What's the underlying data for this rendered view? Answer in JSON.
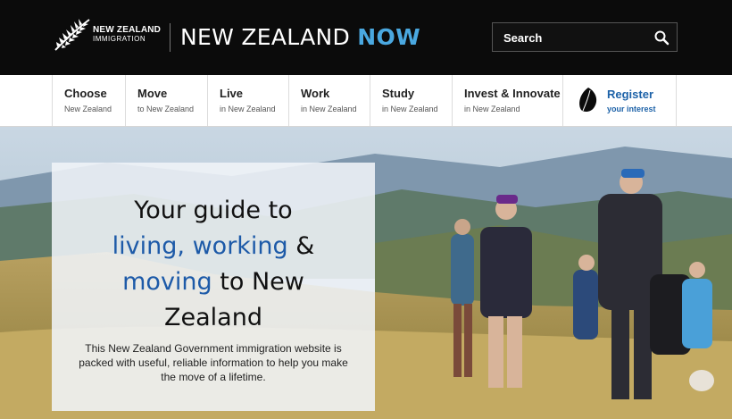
{
  "header": {
    "logo_line1": "NEW ZEALAND",
    "logo_line2": "IMMIGRATION",
    "logo_icon": "silver-fern-icon",
    "brand_main": "NEW ZEALAND",
    "brand_accent": "NOW",
    "search_placeholder": "Search",
    "search_icon": "search-icon"
  },
  "nav": {
    "items": [
      {
        "title": "Choose",
        "sub": "New Zealand"
      },
      {
        "title": "Move",
        "sub": "to New Zealand"
      },
      {
        "title": "Live",
        "sub": "in New Zealand"
      },
      {
        "title": "Work",
        "sub": "in New Zealand"
      },
      {
        "title": "Study",
        "sub": "in New Zealand"
      },
      {
        "title": "Invest & Innovate",
        "sub": "in New Zealand"
      }
    ],
    "register": {
      "title": "Register",
      "sub": "your interest",
      "icon": "fern-icon"
    }
  },
  "hero": {
    "headline_line1": "Your guide to",
    "hl_living": "living,",
    "hl_working": "working",
    "amp": " &",
    "hl_moving": "moving",
    "to_new": " to New",
    "zealand": "Zealand",
    "blurb": "This New Zealand Government immigration website is packed with useful, reliable information to help you make the move of a lifetime."
  },
  "colors": {
    "header_bg": "#0b0b0b",
    "accent_blue": "#1d5aa8",
    "now_blue": "#4aa8e0"
  }
}
